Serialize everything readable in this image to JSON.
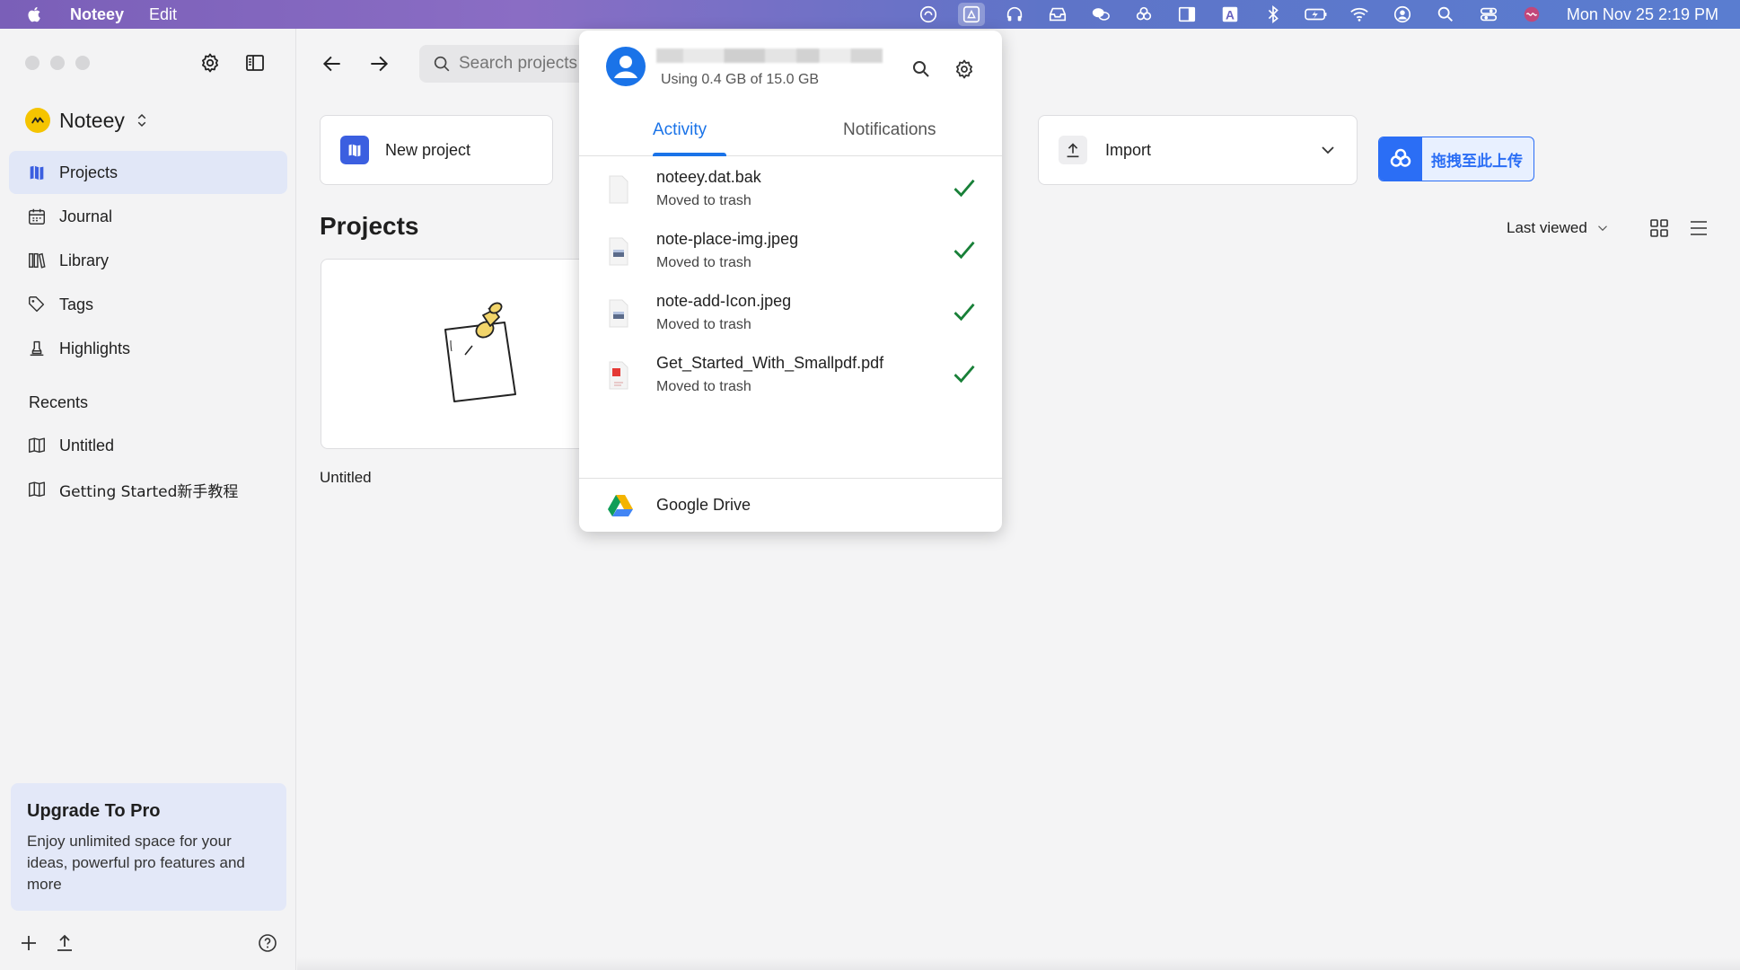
{
  "menubar": {
    "app_name": "Noteey",
    "menu_edit": "Edit",
    "clock": "Mon Nov 25  2:19 PM",
    "status_icons": [
      "cloud-sync-icon",
      "google-drive-icon",
      "headphones-icon",
      "inbox-icon",
      "wechat-icon",
      "baidu-netdisk-icon",
      "sidebar-icon",
      "input-method-icon",
      "bluetooth-icon",
      "battery-icon",
      "wifi-icon",
      "user-icon",
      "spotlight-icon",
      "control-center-icon",
      "siri-icon"
    ],
    "input_method_label": "A"
  },
  "sidebar": {
    "workspace_name": "Noteey",
    "nav_items": [
      {
        "label": "Projects",
        "icon": "projects-icon",
        "active": true
      },
      {
        "label": "Journal",
        "icon": "calendar-icon",
        "active": false
      },
      {
        "label": "Library",
        "icon": "library-icon",
        "active": false
      },
      {
        "label": "Tags",
        "icon": "tag-icon",
        "active": false
      },
      {
        "label": "Highlights",
        "icon": "highlighter-icon",
        "active": false
      }
    ],
    "recents_label": "Recents",
    "recents": [
      {
        "label": "Untitled",
        "icon": "book-icon"
      },
      {
        "label": "Getting Started新手教程",
        "icon": "book-icon"
      }
    ],
    "upgrade": {
      "title": "Upgrade To Pro",
      "body": "Enjoy unlimited space for your ideas, powerful pro features and more"
    }
  },
  "main": {
    "search_placeholder": "Search projects",
    "new_project_label": "New project",
    "import_label": "Import",
    "baidu_label": "拖拽至此上传",
    "projects_title": "Projects",
    "sort_label": "Last viewed",
    "projects": [
      {
        "name": "Untitled"
      }
    ]
  },
  "drive_popup": {
    "storage_text": "Using 0.4 GB of 15.0 GB",
    "tabs": [
      {
        "label": "Activity",
        "active": true
      },
      {
        "label": "Notifications",
        "active": false
      }
    ],
    "activity": [
      {
        "file": "noteey.dat.bak",
        "status": "Moved to trash",
        "type": "generic"
      },
      {
        "file": "note-place-img.jpeg",
        "status": "Moved to trash",
        "type": "image"
      },
      {
        "file": "note-add-Icon.jpeg",
        "status": "Moved to trash",
        "type": "image"
      },
      {
        "file": "Get_Started_With_Smallpdf.pdf",
        "status": "Moved to trash",
        "type": "pdf"
      }
    ],
    "footer_label": "Google Drive"
  },
  "colors": {
    "accent_blue": "#1a73e8",
    "check_green": "#188038",
    "sidebar_active": "#e1e7f7",
    "noteey_blue": "#3b5fe0",
    "baidu_blue": "#2b6ef5"
  }
}
